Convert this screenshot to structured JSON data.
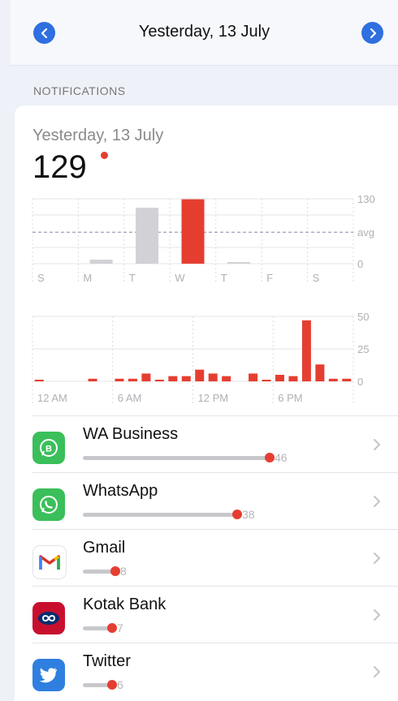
{
  "header": {
    "title": "Yesterday, 13 July",
    "prev_icon": "chevron-left-icon",
    "next_icon": "chevron-right-icon",
    "accent_color": "#2f6fdf"
  },
  "section_label": "NOTIFICATIONS",
  "summary": {
    "date": "Yesterday, 13 July",
    "total": "129",
    "highlight_color": "#e53e30"
  },
  "chart_data": [
    {
      "type": "bar",
      "categories": [
        "S",
        "M",
        "T",
        "W",
        "T",
        "F",
        "S"
      ],
      "values": [
        0,
        8,
        112,
        129,
        2,
        0,
        0
      ],
      "highlight_index": 3,
      "y_ticks": [
        "130",
        "avg",
        "0"
      ],
      "ylim": [
        0,
        130
      ],
      "average": 63
    },
    {
      "type": "bar",
      "x_ticks": [
        "12 AM",
        "6 AM",
        "12 PM",
        "6 PM"
      ],
      "x": [
        0,
        1,
        2,
        3,
        4,
        5,
        6,
        7,
        8,
        9,
        10,
        11,
        12,
        13,
        14,
        15,
        16,
        17,
        18,
        19,
        20,
        21,
        22,
        23
      ],
      "values": [
        1,
        0,
        0,
        0,
        2,
        0,
        2,
        2,
        6,
        1,
        4,
        4,
        9,
        6,
        4,
        0,
        6,
        1,
        5,
        4,
        47,
        13,
        2,
        2
      ],
      "y_ticks": [
        "50",
        "25",
        "0"
      ],
      "ylim": [
        0,
        50
      ]
    }
  ],
  "apps": [
    {
      "name": "WA Business",
      "count": "46",
      "value": 46,
      "icon": "whatsapp-business-icon"
    },
    {
      "name": "WhatsApp",
      "count": "38",
      "value": 38,
      "icon": "whatsapp-icon"
    },
    {
      "name": "Gmail",
      "count": "8",
      "value": 8,
      "icon": "gmail-icon"
    },
    {
      "name": "Kotak Bank",
      "count": "7",
      "value": 7,
      "icon": "kotak-bank-icon"
    },
    {
      "name": "Twitter",
      "count": "6",
      "value": 6,
      "icon": "twitter-icon"
    }
  ]
}
